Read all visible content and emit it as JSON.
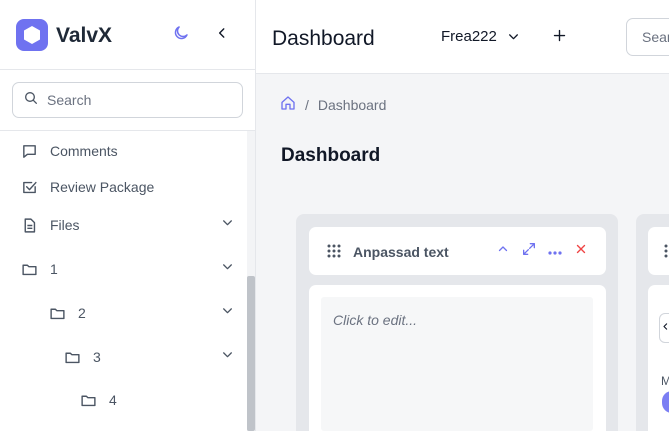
{
  "sidebar": {
    "brand": "ValvX",
    "search_placeholder": "Search",
    "items": [
      {
        "label": "Comments",
        "icon": "comment-icon"
      },
      {
        "label": "Review Package",
        "icon": "checkbox-icon"
      },
      {
        "label": "Files",
        "icon": "file-icon"
      },
      {
        "label": "1",
        "icon": "folder-icon"
      },
      {
        "label": "2",
        "icon": "folder-icon"
      },
      {
        "label": "3",
        "icon": "folder-icon"
      },
      {
        "label": "4",
        "icon": "folder-icon"
      }
    ]
  },
  "topbar": {
    "title": "Dashboard",
    "workspace": "Frea222",
    "search_placeholder": "Search"
  },
  "breadcrumb": {
    "separator": "/",
    "current": "Dashboard"
  },
  "page": {
    "heading": "Dashboard"
  },
  "widget": {
    "title": "Anpassad text",
    "placeholder": "Click to edit..."
  },
  "widget2": {
    "letter": "M"
  },
  "colors": {
    "accent": "#6f72f0",
    "close": "#ef4444",
    "board": "#e5e7eb"
  }
}
